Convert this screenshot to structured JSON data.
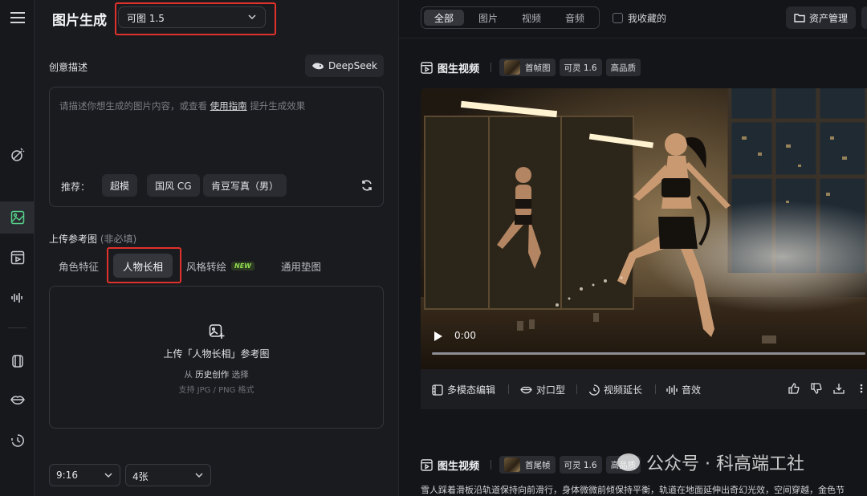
{
  "sidebar": {
    "icons": [
      "hamburger-menu-icon",
      "magic-wand-icon",
      "image-icon",
      "video-icon",
      "audio-wave-icon",
      "canvas-icon",
      "lips-icon",
      "history-icon"
    ]
  },
  "left_panel": {
    "title": "图片生成",
    "model_selector": {
      "value": "可图 1.5"
    },
    "creative_label": "创意描述",
    "deepseek_label": "DeepSeek",
    "prompt": {
      "placeholder_prefix": "请描述你想生成的图片内容，或查看",
      "guide_link": "使用指南",
      "placeholder_suffix": "提升生成效果",
      "recommend_label": "推荐：",
      "chips": [
        "超模",
        "国风 CG",
        "肯豆写真（男）"
      ]
    },
    "upload_label": "上传参考图",
    "upload_optional": "(非必填)",
    "ref_tabs": [
      {
        "label": "角色特征"
      },
      {
        "label": "人物长相"
      },
      {
        "label": "风格转绘",
        "badge": "NEW"
      },
      {
        "label": "通用垫图"
      }
    ],
    "active_ref_tab": "人物长相",
    "upload_box": {
      "title": "上传「人物长相」参考图",
      "from_prefix": "从",
      "from_link": "历史创作",
      "from_suffix": "选择",
      "formats": "支持 JPG / PNG 格式"
    },
    "ratio_select": "9:16",
    "count_select": "4张"
  },
  "right_panel": {
    "filter_tabs": [
      "全部",
      "图片",
      "视频",
      "音频"
    ],
    "active_filter": "全部",
    "favorites_label": "我收藏的",
    "asset_button": "资产管理",
    "card1": {
      "title": "图生视频",
      "tags": [
        "首帧图",
        "可灵 1.6",
        "高品质"
      ]
    },
    "video": {
      "time": "0:00",
      "progress": 0
    },
    "toolbar": [
      "多模态编辑",
      "对口型",
      "视频延长",
      "音效"
    ],
    "toolbar_right_icons": [
      "thumbs-up-icon",
      "thumbs-down-icon",
      "download-icon",
      "more-icon"
    ],
    "card2": {
      "title": "图生视频",
      "tags": [
        "首尾帧",
        "可灵 1.6",
        "高品质"
      ],
      "description": "雪人踩着滑板沿轨道保持向前滑行，身体微微前倾保持平衡，轨道在地面延伸出奇幻光效，空间穿越，金色节"
    },
    "watermark": "公众号 · 科高端工社"
  },
  "colors": {
    "accent": "#57d08a",
    "highlight_box": "#e0322b",
    "new_badge": "#8fdc4f"
  }
}
